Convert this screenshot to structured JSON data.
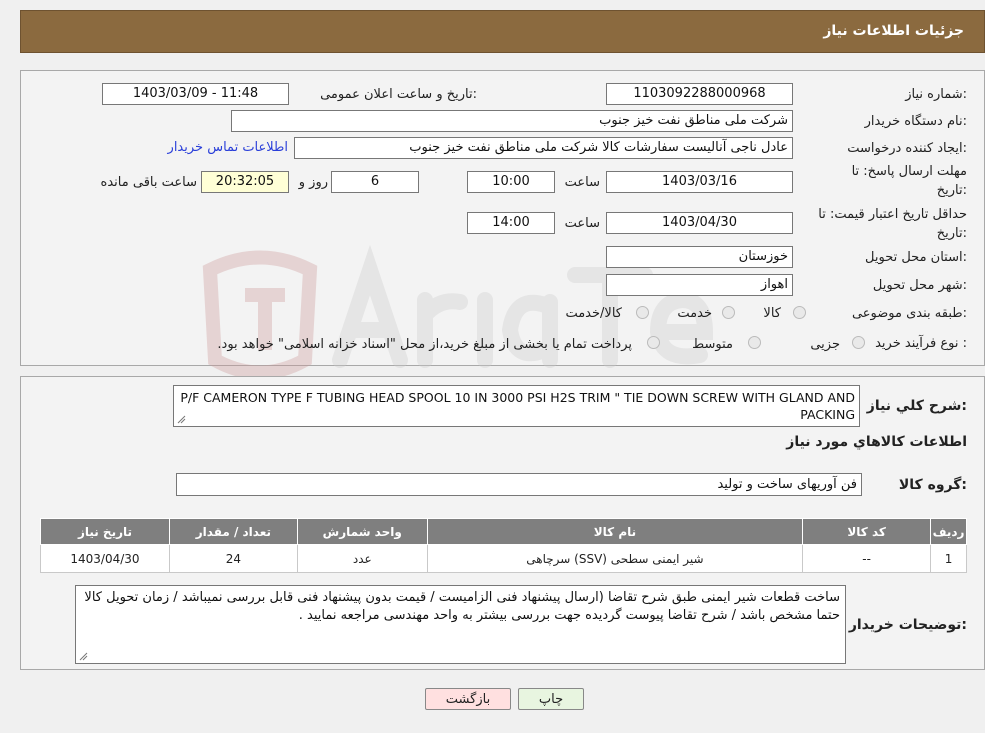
{
  "header": {
    "title": "جزئیات اطلاعات نیاز"
  },
  "form": {
    "need_number_label": "شماره نیاز:",
    "need_number": "1103092288000968",
    "announce_label": "تاریخ و ساعت اعلان عمومی:",
    "announce_value": "1403/03/09 - 11:48",
    "buyer_org_label": "نام دستگاه خریدار:",
    "buyer_org": "شرکت ملی مناطق نفت خیز جنوب",
    "creator_label": "ایجاد کننده درخواست:",
    "creator": "عادل  ناجی آنالیست سفارشات کالا  شرکت ملی مناطق نفت خیز جنوب",
    "contact_link": "اطلاعات تماس خریدار",
    "deadline_label_1": "مهلت ارسال پاسخ: تا",
    "deadline_label_2": "تاریخ:",
    "deadline_date": "1403/03/16",
    "time_label": "ساعت",
    "deadline_time": "10:00",
    "days_value": "6",
    "days_label": "روز و",
    "remaining_time": "20:32:05",
    "remaining_label": "ساعت باقی مانده",
    "validity_label_1": "حداقل تاریخ اعتبار قیمت: تا",
    "validity_label_2": "تاریخ:",
    "validity_date": "1403/04/30",
    "validity_time": "14:00",
    "province_label": "استان محل تحویل:",
    "province": "خوزستان",
    "city_label": "شهر محل تحویل:",
    "city": "اهواز",
    "category_label": "طبقه بندی موضوعی:",
    "category_options": [
      "کالا",
      "خدمت",
      "کالا/خدمت"
    ],
    "process_label": "نوع فرآیند خرید :",
    "process_options": [
      "جزیی",
      "متوسط"
    ],
    "process_note": "پرداخت تمام یا بخشی از مبلغ خرید،از محل \"اسناد خزانه اسلامی\" خواهد بود."
  },
  "details": {
    "description_label": "شرح كلي نياز:",
    "description": "P/F  CAMERON TYPE  F TUBING HEAD SPOOL 10 IN 3000 PSI H2S TRIM  \" TIE DOWN SCREW WITH GLAND AND PACKING",
    "items_heading": "اطلاعات كالاهاي مورد نياز",
    "group_label": "گروه کالا:",
    "group_value": "فن آوریهای ساخت و تولید",
    "table": {
      "headers": [
        "ردیف",
        "کد کالا",
        "نام کالا",
        "واحد شمارش",
        "تعداد / مقدار",
        "تاریخ نیاز"
      ],
      "rows": [
        [
          "1",
          "--",
          "شیر ایمنی سطحی (SSV) سرچاهی",
          "عدد",
          "24",
          "1403/04/30"
        ]
      ]
    },
    "buyer_notes_label": "توضیحات خریدار:",
    "buyer_notes": "ساخت قطعات شیر ایمنی طبق شرح تقاضا (ارسال پیشنهاد فنی الزامیست / قیمت بدون پیشنهاد فنی قابل بررسی نمیباشد / زمان تحویل کالا حتما مشخص باشد / شرح تقاضا پیوست گردیده جهت بررسی بیشتر به واحد مهندسی مراجعه نمایید ."
  },
  "buttons": {
    "print": "چاپ",
    "back": "بازگشت"
  },
  "colors": {
    "header_bg": "#8b6a3f",
    "link": "#2a3fd9",
    "back_button": "#ffe0e0",
    "print_button": "#e8f5e0"
  }
}
